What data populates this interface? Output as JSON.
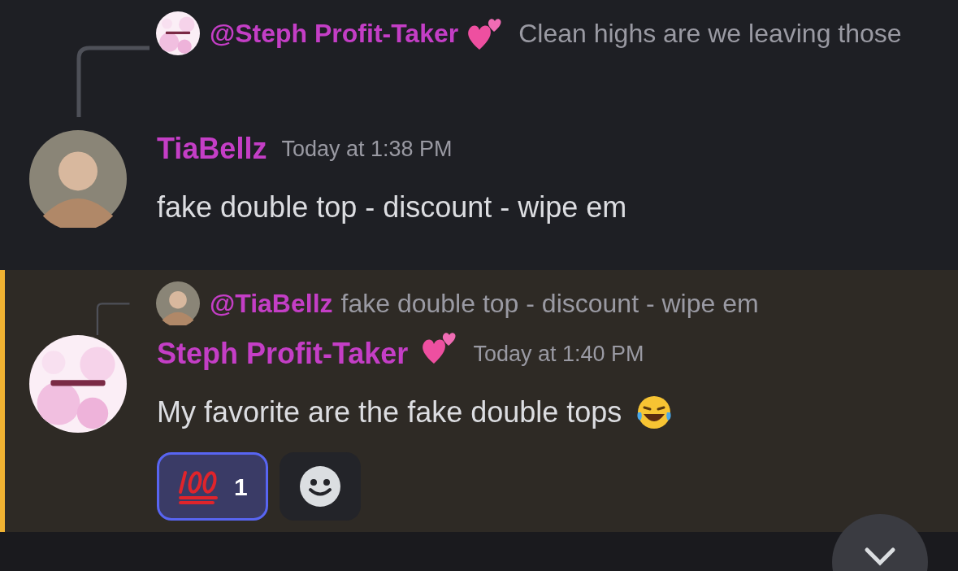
{
  "messages": [
    {
      "highlighted": false,
      "reply": {
        "author": "@Steph Profit-Taker",
        "author_hearts": true,
        "text": "Clean highs are we leaving those"
      },
      "author": "TiaBellz",
      "author_hearts": false,
      "time": "Today at 1:38 PM",
      "text": "fake double top - discount - wipe em",
      "laughing_emoji": false,
      "add_reaction": false
    },
    {
      "highlighted": true,
      "reply": {
        "author": "@TiaBellz",
        "author_hearts": false,
        "text": "fake double top - discount - wipe em"
      },
      "author": "Steph Profit-Taker",
      "author_hearts": true,
      "time": "Today at 1:40 PM",
      "text": "My favorite are the fake double tops",
      "laughing_emoji": true,
      "reactions": [
        {
          "kind": "hundred",
          "count": "1",
          "selected": true
        }
      ],
      "add_reaction": true
    }
  ],
  "scroll_down_button": true
}
